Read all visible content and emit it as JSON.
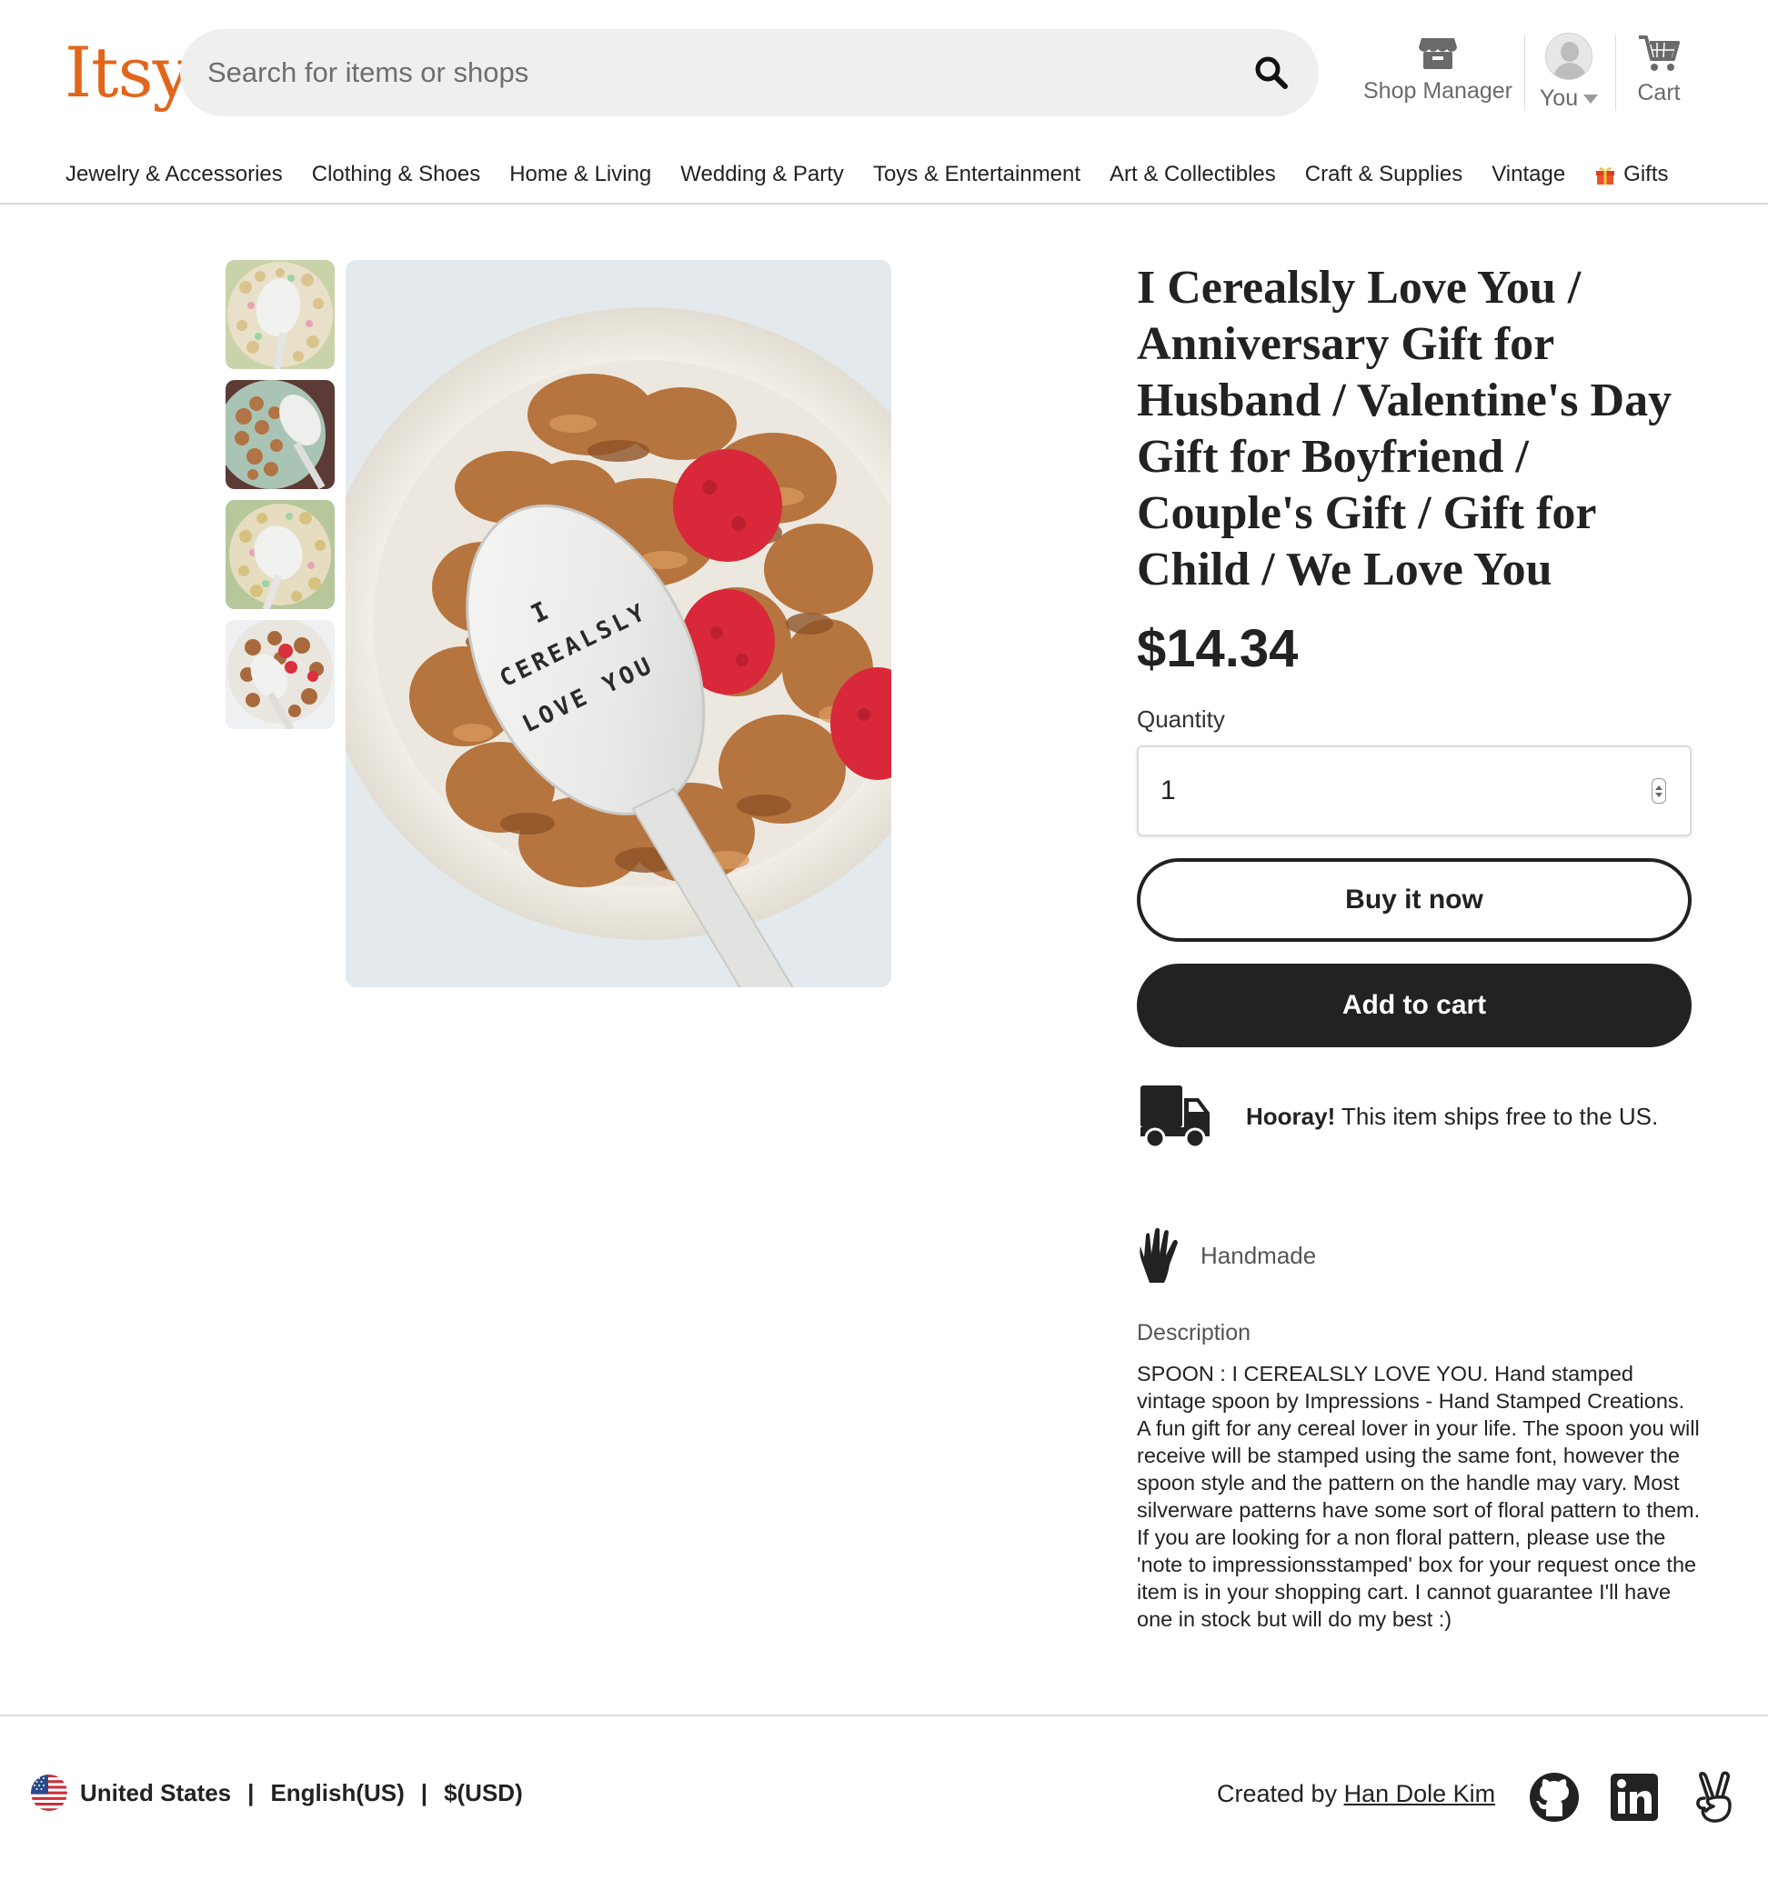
{
  "header": {
    "logo": "Itsy",
    "search_placeholder": "Search for items or shops",
    "shop_manager_label": "Shop Manager",
    "you_label": "You",
    "cart_label": "Cart"
  },
  "categories": [
    "Jewelry & Accessories",
    "Clothing & Shoes",
    "Home & Living",
    "Wedding & Party",
    "Toys & Entertainment",
    "Art & Collectibles",
    "Craft & Supplies",
    "Vintage",
    "Gifts"
  ],
  "gallery": {
    "main_image_text": [
      "I",
      "CEREALSLY",
      "LOVE YOU"
    ],
    "thumbnail_count": 4
  },
  "product": {
    "title": "I Cerealsly Love You / Anniversary Gift for Husband / Valentine's Day Gift for Boyfriend / Couple's Gift / Gift for Child / We Love You",
    "price": "$14.34",
    "quantity_label": "Quantity",
    "quantity_value": "1",
    "buy_now_label": "Buy it now",
    "add_to_cart_label": "Add to cart",
    "shipping_bold": "Hooray!",
    "shipping_text": " This item ships free to the US.",
    "handmade_label": "Handmade",
    "description_label": "Description",
    "description": "SPOON : I CEREALSLY LOVE YOU. Hand stamped vintage spoon by Impressions - Hand Stamped Creations. A fun gift for any cereal lover in your life. The spoon you will receive will be stamped using the same font, however the spoon style and the pattern on the handle may vary. Most silverware patterns have some sort of floral pattern to them. If you are looking for a non floral pattern, please use the 'note to impressionsstamped' box for your request once the item is in your shopping cart. I cannot guarantee I'll have one in stock but will do my best :)"
  },
  "footer": {
    "country": "United States",
    "separator": "|",
    "language": "English(US)",
    "currency": "$(USD)",
    "credit_prefix": "Created by ",
    "credit_name": "Han Dole Kim"
  },
  "colors": {
    "brand_orange": "#e1661c",
    "button_dark": "#222222",
    "search_bg": "#efefef"
  },
  "icons": [
    "search-icon",
    "shop-icon",
    "avatar-icon",
    "cart-icon",
    "gift-icon",
    "truck-icon",
    "hand-icon",
    "us-flag-icon",
    "github-icon",
    "linkedin-icon",
    "angellist-icon"
  ]
}
